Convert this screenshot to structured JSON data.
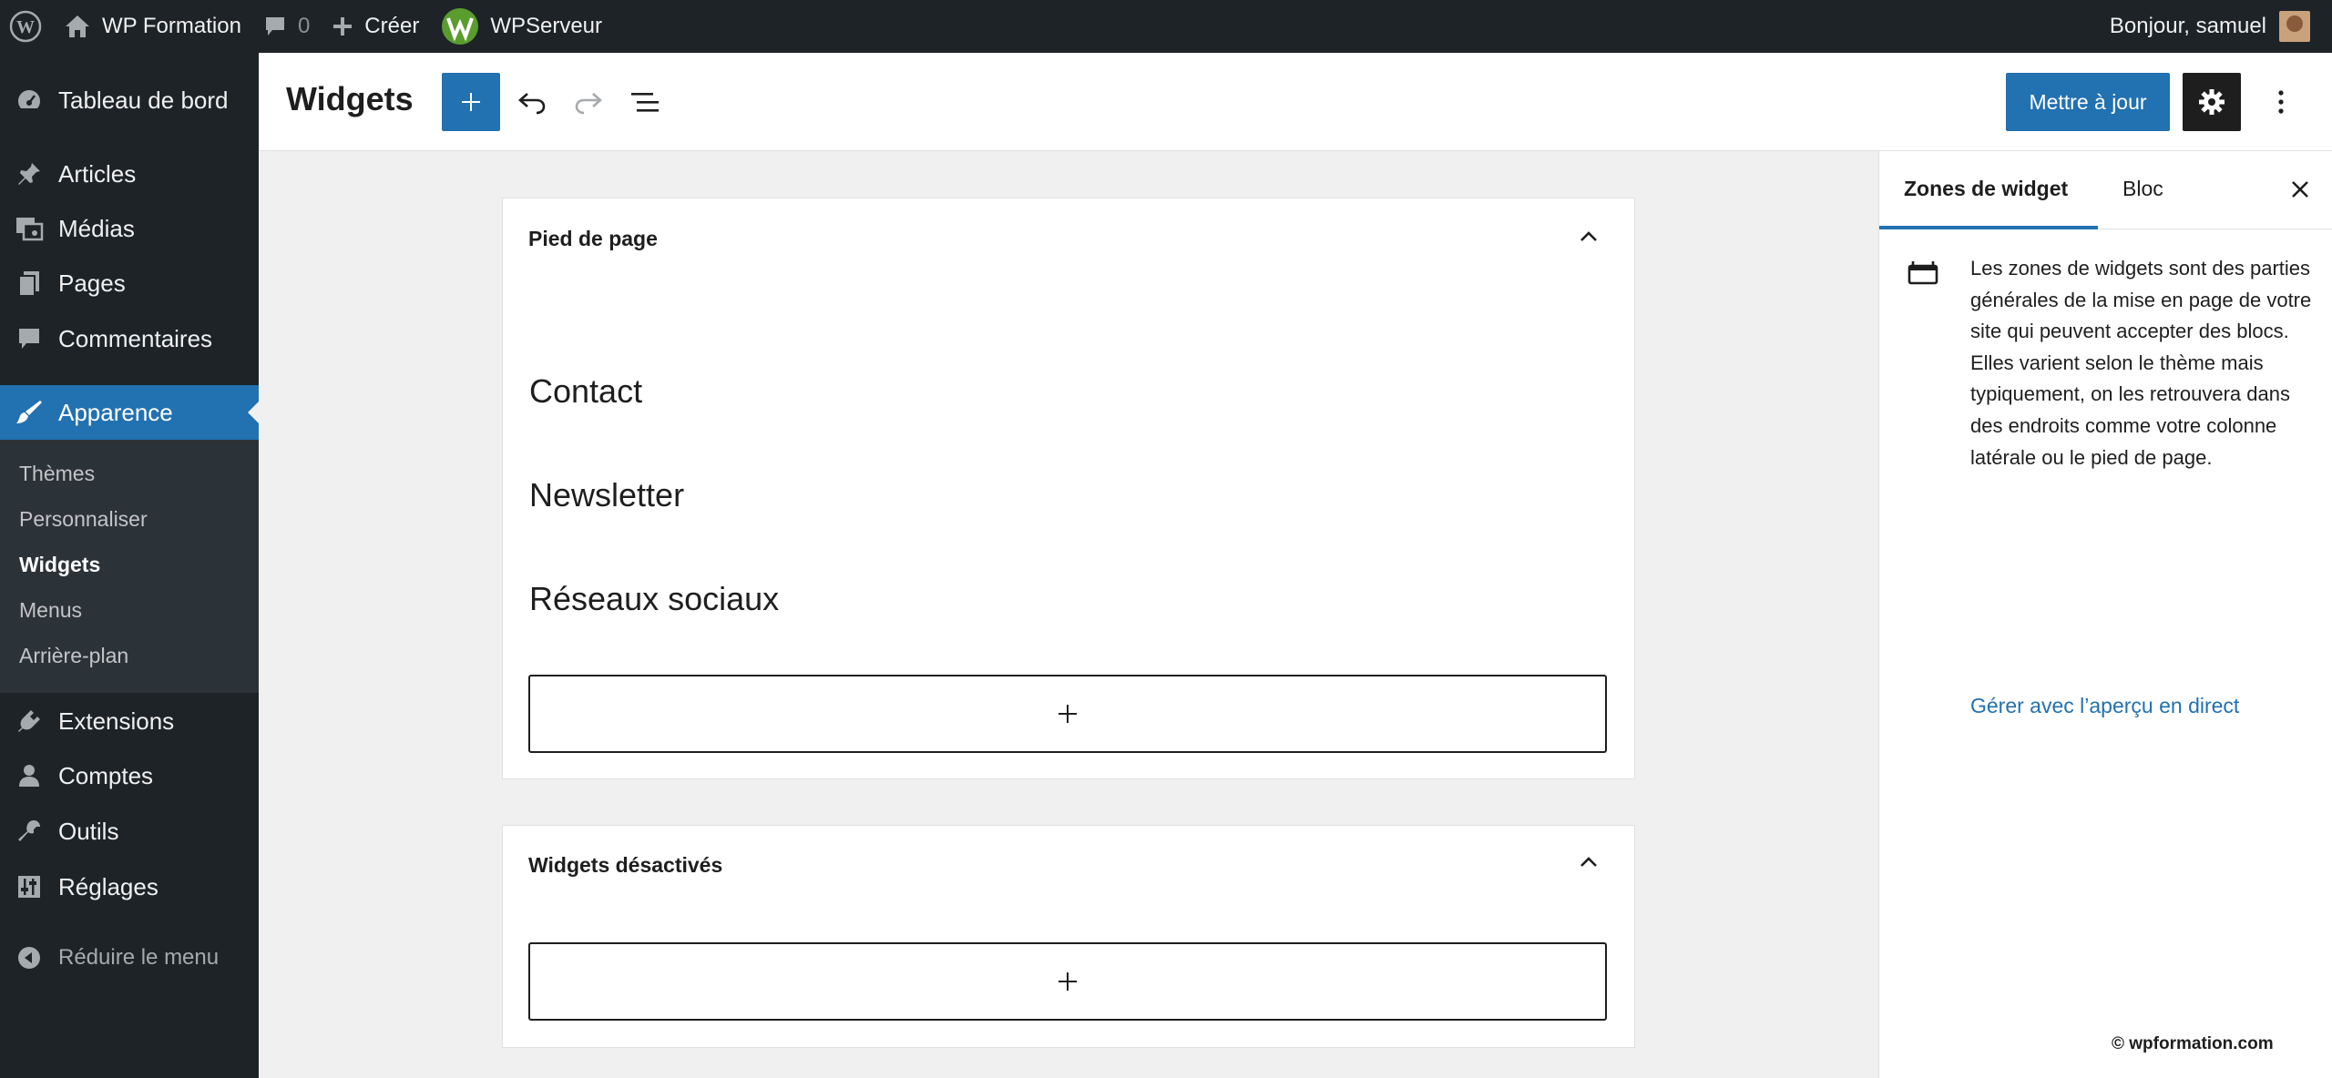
{
  "admin_bar": {
    "site_name": "WP Formation",
    "comments_count": "0",
    "new_label": "Créer",
    "plugin_label": "WPServeur",
    "greeting": "Bonjour, samuel"
  },
  "sidebar": {
    "dashboard": "Tableau de bord",
    "posts": "Articles",
    "media": "Médias",
    "pages": "Pages",
    "comments": "Commentaires",
    "appearance": "Apparence",
    "appearance_sub": [
      "Thèmes",
      "Personnaliser",
      "Widgets",
      "Menus",
      "Arrière-plan"
    ],
    "plugins": "Extensions",
    "users": "Comptes",
    "tools": "Outils",
    "settings": "Réglages",
    "collapse": "Réduire le menu"
  },
  "header": {
    "title": "Widgets",
    "update_label": "Mettre à jour"
  },
  "widget_areas": [
    {
      "title": "Pied de page",
      "blocks": [
        "Contact",
        "Newsletter",
        "Réseaux sociaux"
      ]
    },
    {
      "title": "Widgets désactivés",
      "blocks": []
    }
  ],
  "panel": {
    "tab_widget_areas": "Zones de widget",
    "tab_block": "Bloc",
    "description": "Les zones de widgets sont des parties générales de la mise en page de votre site qui peuvent accepter des blocs. Elles varient selon le thème mais typiquement, on les retrouvera dans des endroits comme votre colonne latérale ou le pied de page.",
    "link": "Gérer avec l’aperçu en direct"
  },
  "watermark": "© wpformation.com",
  "colors": {
    "admin_dark": "#1d2327",
    "submenu_bg": "#2c3338",
    "accent": "#2271b1",
    "canvas_bg": "#f0f0f1"
  }
}
